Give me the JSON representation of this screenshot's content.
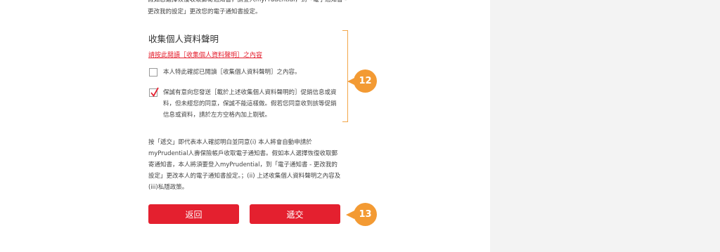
{
  "top_note": "假如您選擇恢復收取郵寄通知書，請登入myPrudential，到「電子通知書 - 更改我的設定」更改您的電子通知書設定。",
  "privacy": {
    "title": "收集個人資料聲明",
    "link": "請按此閱讀［收集個人資料聲明］之內容",
    "confirm_text": "本人特此確認已閱讀［收集個人資料聲明］之內容。",
    "marketing_text": "保誠有意向您發送［載於上述收集個人資料聲明的］促銷信息或資料，但未經您的同意，保誠不能這樣做。假若您同意收到該等促銷信息或資料，請於左方空格內加上剔號。"
  },
  "annotations": {
    "badge_12": "12",
    "badge_13": "13"
  },
  "submit_note": "按「遞交」即代表本人確認明白並同意(i) 本人將會自動申請於myPrudential人壽保險帳戶收取電子通知書。假如本人選擇恢復收取郵寄通知書，本人將須要登入myPrudential，到「電子通知書 - 更改我的設定」更改本人的電子通知書設定。；(ii) 上述收集個人資料聲明之內容及(iii)私隱政策。",
  "buttons": {
    "back": "返回",
    "submit": "遞交"
  },
  "checkboxes": {
    "confirm_checked": false,
    "marketing_checked": true
  },
  "colors": {
    "brand_red": "#e4202f",
    "annotation_orange": "#f39a33",
    "panel_grey": "#f3f3f3"
  }
}
